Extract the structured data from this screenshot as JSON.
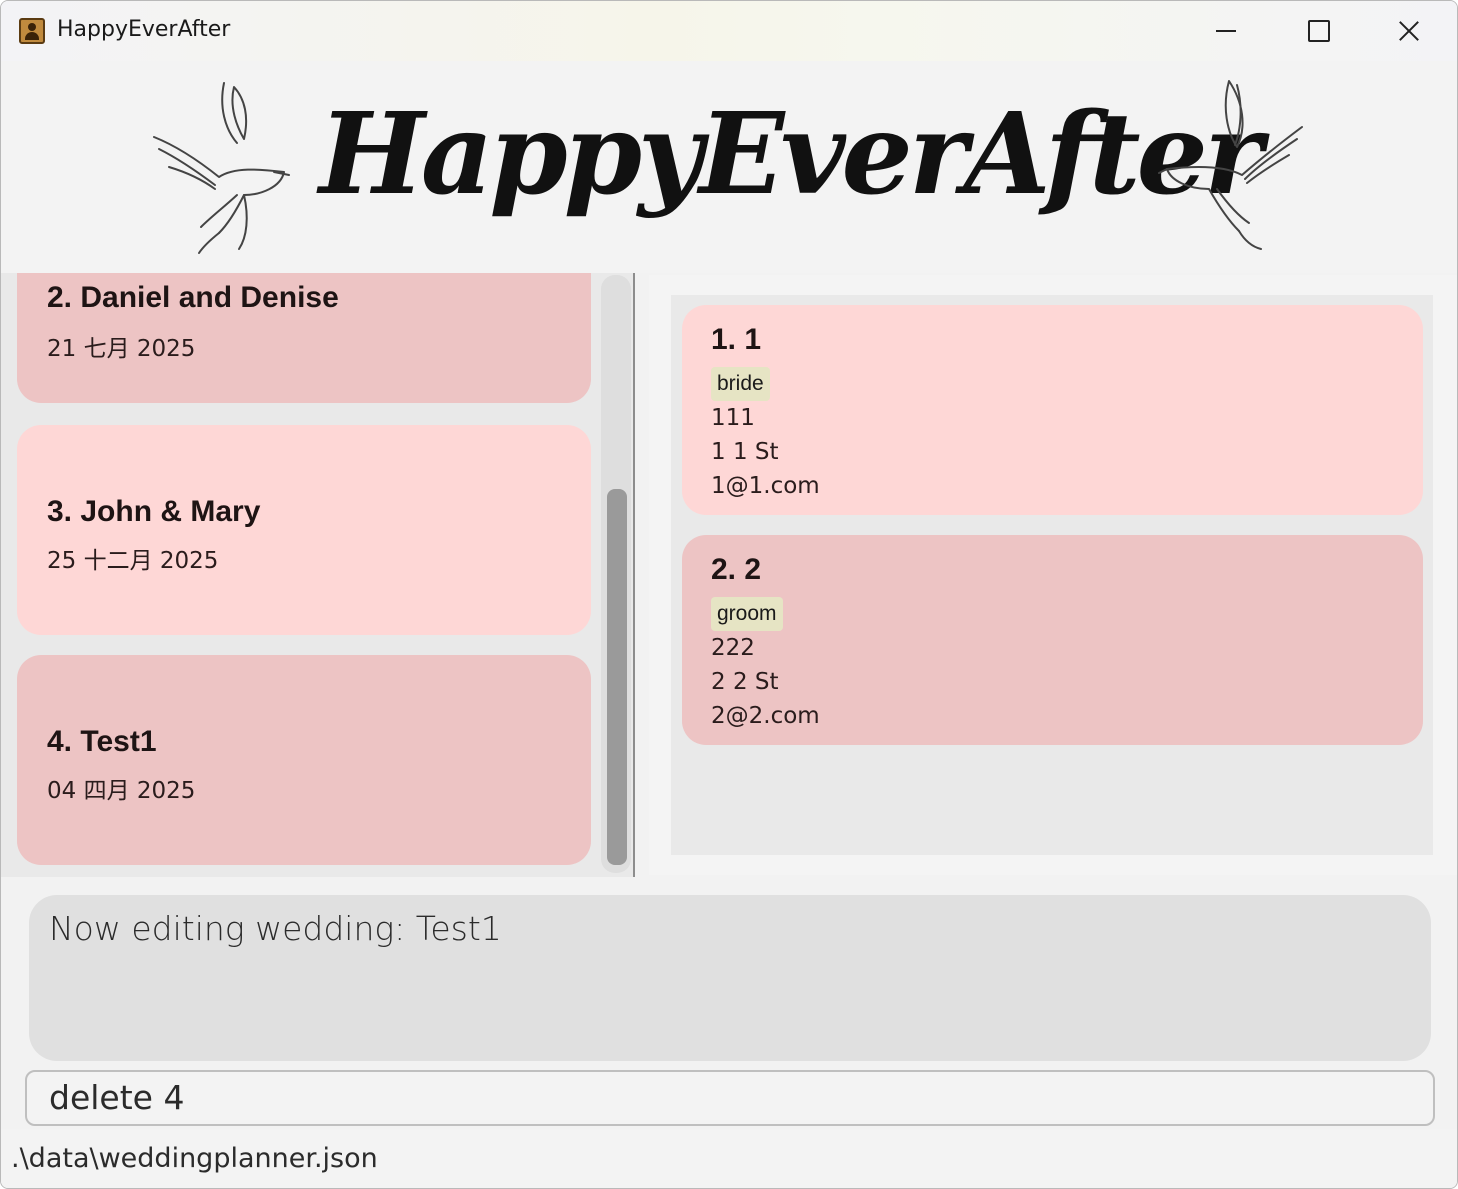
{
  "window": {
    "title": "HappyEverAfter"
  },
  "banner": {
    "logo_text": "HappyEverAfter"
  },
  "weddings": [
    {
      "name": "2. Daniel and Denise",
      "date": "21 七月 2025"
    },
    {
      "name": "3. John & Mary",
      "date": "25 十二月 2025"
    },
    {
      "name": "4. Test1",
      "date": "04 四月 2025"
    }
  ],
  "persons": [
    {
      "name": "1. 1",
      "tag": "bride",
      "phone": "111",
      "address": "1 1 St",
      "email": "1@1.com"
    },
    {
      "name": "2. 2",
      "tag": "groom",
      "phone": "222",
      "address": "2 2 St",
      "email": "2@2.com"
    }
  ],
  "result": {
    "text": "Now editing wedding: Test1"
  },
  "command": {
    "value": "delete 4"
  },
  "status": {
    "path": ".\\data\\weddingplanner.json"
  },
  "icons": {
    "app": "address-book-icon",
    "banner_left": "dove-icon",
    "banner_right": "dove-icon"
  },
  "colors": {
    "card_dark": "#edc4c4",
    "card_light": "#fed7d6",
    "tag_bg": "#e6e4c4"
  }
}
